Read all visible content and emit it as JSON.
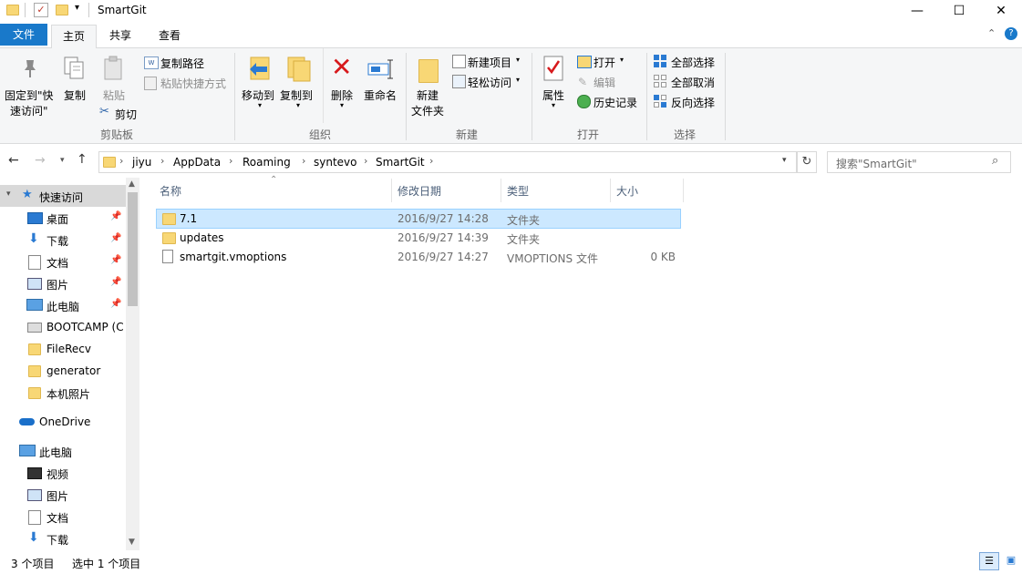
{
  "window": {
    "title": "SmartGit",
    "minimize_glyph": "—",
    "maximize_glyph": "☐",
    "close_glyph": "✕",
    "qat_dropdown_glyph": "▾"
  },
  "tabs": {
    "file": "文件",
    "home": "主页",
    "share": "共享",
    "view": "查看"
  },
  "ribbon": {
    "clipboard": {
      "pin_line1": "固定到\"快",
      "pin_line2": "速访问\"",
      "copy": "复制",
      "paste": "粘贴",
      "copy_path": "复制路径",
      "paste_shortcut": "粘贴快捷方式",
      "cut": "剪切",
      "group": "剪贴板"
    },
    "organize": {
      "move_to": "移动到",
      "copy_to": "复制到",
      "delete": "删除",
      "rename": "重命名",
      "group": "组织"
    },
    "new": {
      "new_folder_line1": "新建",
      "new_folder_line2": "文件夹",
      "new_item": "新建项目",
      "easy_access": "轻松访问",
      "group": "新建"
    },
    "open": {
      "properties": "属性",
      "open": "打开",
      "edit": "编辑",
      "history": "历史记录",
      "group": "打开"
    },
    "select": {
      "select_all": "全部选择",
      "select_none": "全部取消",
      "invert": "反向选择",
      "group": "选择"
    }
  },
  "address": {
    "breadcrumbs": [
      "jiyu",
      "AppData",
      "Roaming",
      "syntevo",
      "SmartGit"
    ],
    "search_placeholder": "搜索\"SmartGit\""
  },
  "nav": {
    "quick_access": "快速访问",
    "quick_items": [
      "桌面",
      "下载",
      "文档",
      "图片",
      "此电脑",
      "BOOTCAMP (C",
      "FileRecv",
      "generator",
      "本机照片"
    ],
    "onedrive": "OneDrive",
    "this_pc": "此电脑",
    "pc_items": [
      "视频",
      "图片",
      "文档",
      "下载"
    ]
  },
  "columns": {
    "name": "名称",
    "modified": "修改日期",
    "type": "类型",
    "size": "大小"
  },
  "files": [
    {
      "name": "7.1",
      "modified": "2016/9/27 14:28",
      "type": "文件夹",
      "size": "",
      "kind": "folder",
      "selected": true
    },
    {
      "name": "updates",
      "modified": "2016/9/27 14:39",
      "type": "文件夹",
      "size": "",
      "kind": "folder",
      "selected": false
    },
    {
      "name": "smartgit.vmoptions",
      "modified": "2016/9/27 14:27",
      "type": "VMOPTIONS 文件",
      "size": "0 KB",
      "kind": "file",
      "selected": false
    }
  ],
  "status": {
    "count": "3 个项目",
    "selected": "选中 1 个项目"
  },
  "colors": {
    "accent": "#1979ca",
    "selection_bg": "#cce8ff",
    "selection_border": "#99d1ff",
    "folder": "#f8d775"
  }
}
